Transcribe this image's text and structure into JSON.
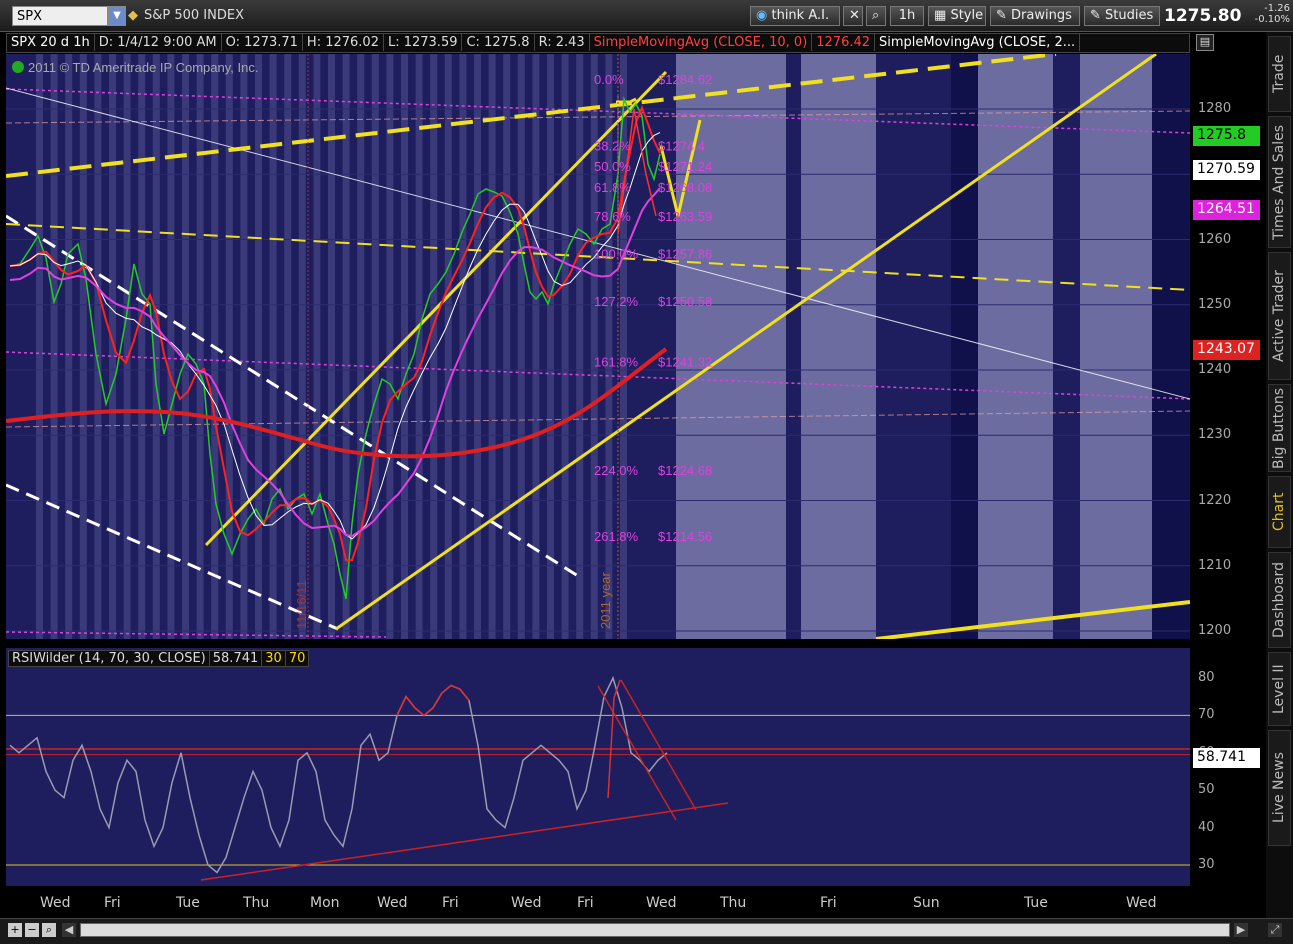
{
  "toolbar": {
    "symbol": "SPX",
    "index_name": "S&P 500 INDEX",
    "think_label": "think A.I.",
    "period_label": "1h",
    "style_label": "Style",
    "drawings_label": "Drawings",
    "studies_label": "Studies",
    "last_price": "1275.80",
    "change_line1": "-1.26",
    "change_line2": "-0.10%"
  },
  "infobar": {
    "symbol": "SPX 20 d 1h",
    "date": "D: 1/4/12 9:00 AM",
    "open": "O: 1273.71",
    "high": "H: 1276.02",
    "low": "L: 1273.59",
    "close": "C: 1275.8",
    "range": "R: 2.43",
    "sma10_label": "SimpleMovingAvg (CLOSE, 10, 0)",
    "sma10_value": "1276.42",
    "sma2_label": "SimpleMovingAvg (CLOSE, 2..."
  },
  "copyright": "2011 © TD Ameritrade IP Company, Inc.",
  "annotations": {
    "date_marker": "11/16/11",
    "year_marker": "2011 year"
  },
  "fib_levels": [
    {
      "pct": "0.0%",
      "price": "$1284.62",
      "value": 1284.62
    },
    {
      "pct": "38.2%",
      "price": "$1274.4",
      "value": 1274.4
    },
    {
      "pct": "50.0%",
      "price": "$1271.24",
      "value": 1271.24
    },
    {
      "pct": "61.8%",
      "price": "$1268.08",
      "value": 1268.08
    },
    {
      "pct": "78.6%",
      "price": "$1263.59",
      "value": 1263.59
    },
    {
      "pct": "100.0%",
      "price": "$1257.86",
      "value": 1257.86
    },
    {
      "pct": "127.2%",
      "price": "$1250.58",
      "value": 1250.58
    },
    {
      "pct": "161.8%",
      "price": "$1241.32",
      "value": 1241.32
    },
    {
      "pct": "224.0%",
      "price": "$1224.68",
      "value": 1224.68
    },
    {
      "pct": "261.8%",
      "price": "$1214.56",
      "value": 1214.56
    }
  ],
  "price_axis": {
    "ticks": [
      1280,
      1270,
      1260,
      1250,
      1240,
      1230,
      1220,
      1210,
      1200
    ],
    "badges": [
      {
        "label": "1275.8",
        "value": 1275.8,
        "bg": "#22cc22",
        "fg": "#000000"
      },
      {
        "label": "1270.59",
        "value": 1270.59,
        "bg": "#ffffff",
        "fg": "#000000"
      },
      {
        "label": "1264.51",
        "value": 1264.51,
        "bg": "#dd22dd",
        "fg": "#ffffff"
      },
      {
        "label": "1243.07",
        "value": 1243.07,
        "bg": "#dd2222",
        "fg": "#ffffff"
      }
    ]
  },
  "rsi": {
    "label": "RSIWilder (14, 70, 30, CLOSE)",
    "value": "58.741",
    "ob_label": "30",
    "os_label": "70",
    "ticks": [
      80,
      70,
      60,
      50,
      40,
      30
    ]
  },
  "time_axis": [
    "Wed",
    "Fri",
    "Tue",
    "Thu",
    "Mon",
    "Wed",
    "Fri",
    "Wed",
    "Fri",
    "Wed",
    "Thu",
    "Fri",
    "Sun",
    "Tue",
    "Wed"
  ],
  "sidebar_tabs": [
    "Trade",
    "Times And Sales",
    "Active Trader",
    "Big Buttons",
    "Chart",
    "Dashboard",
    "Level II",
    "Live News"
  ],
  "colors": {
    "pane_bg": "#1e1e5e",
    "stripe": "#3a3a7a",
    "future_stripe": "#6c6ca0",
    "yellow": "#f0e020",
    "magenta": "#e040e0",
    "red": "#e02020",
    "fib_text": "#e040e0"
  }
}
